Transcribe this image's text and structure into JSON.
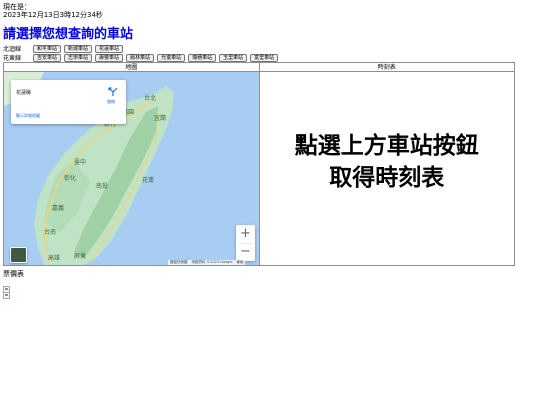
{
  "now": {
    "label": "現在是：",
    "datetime": "2023年12月13日3時12分34秒"
  },
  "page_title": "請選擇您想查詢的車站",
  "lines": [
    {
      "label": "北迴線",
      "stations": [
        "和平車站",
        "新城車站",
        "花蓮車站"
      ]
    },
    {
      "label": "花東線",
      "stations": [
        "吉安車站",
        "志學車站",
        "壽豐車站",
        "鳳林車站",
        "光復車站",
        "瑞穗車站",
        "玉里車站",
        "富里車站"
      ]
    }
  ],
  "panels": {
    "map_header": "地圖",
    "timetable_header": "時刻表"
  },
  "map": {
    "info_card": {
      "place": "花蓮縣",
      "directions": "路線",
      "larger_map": "顯示詳細地圖"
    },
    "labels": {
      "city_taipei": "台北",
      "city_taoyuan": "桃園",
      "city_hsinchu": "新竹",
      "city_taichung": "臺中",
      "city_changhua": "彰化",
      "city_nantou": "南投",
      "city_hualien": "花蓮",
      "city_chiayi": "嘉義",
      "city_tainan": "台南",
      "city_kaohsiung": "高雄",
      "city_pingtung": "屏東",
      "city_yilan": "宜蘭"
    },
    "zoom_in": "+",
    "zoom_out": "−",
    "attribution": [
      "鍵盤快速鍵",
      "地圖資料 ©2023 Google",
      "條款"
    ],
    "colors": {
      "water": "#a8cdf3",
      "land": "#bfe3c4",
      "land_dark": "#9fd0a6",
      "road": "#f4d27a",
      "text": "#3d6b4a"
    }
  },
  "timetable": {
    "prompt_line1": "點選上方車站按鈕",
    "prompt_line2": "取得時刻表"
  },
  "fare_label": "票價表"
}
